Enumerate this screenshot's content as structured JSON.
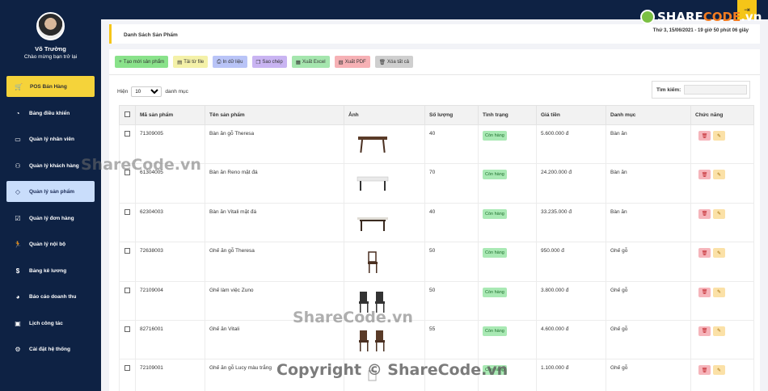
{
  "user": {
    "name": "Võ Trường",
    "welcome": "Chào mừng bạn trở lại"
  },
  "nav": [
    {
      "label": "POS Bán Hàng",
      "icon": "cart-icon",
      "glyph": "🛒"
    },
    {
      "label": "Bảng điều khiển",
      "icon": "dashboard-icon",
      "glyph": "◔"
    },
    {
      "label": "Quản lý nhân viên",
      "icon": "id-card-icon",
      "glyph": "▭"
    },
    {
      "label": "Quản lý khách hàng",
      "icon": "users-icon",
      "glyph": "⚇"
    },
    {
      "label": "Quản lý sản phẩm",
      "icon": "tag-icon",
      "glyph": "◇"
    },
    {
      "label": "Quản lý đơn hàng",
      "icon": "clipboard-check-icon",
      "glyph": "☑"
    },
    {
      "label": "Quản lý nội bộ",
      "icon": "running-icon",
      "glyph": "🏃"
    },
    {
      "label": "Bảng kê lương",
      "icon": "dollar-icon",
      "glyph": "$"
    },
    {
      "label": "Báo cáo doanh thu",
      "icon": "pie-chart-icon",
      "glyph": "◕"
    },
    {
      "label": "Lịch công tác",
      "icon": "calendar-check-icon",
      "glyph": "▣"
    },
    {
      "label": "Cài đặt hệ thống",
      "icon": "gear-icon",
      "glyph": "⚙"
    }
  ],
  "breadcrumb": "Danh Sách Sản Phẩm",
  "date": "Thứ 3, 15/06/2021 - 19 giờ 50 phút 06 giây",
  "toolbar": {
    "add": "Tạo mới sản phẩm",
    "upload": "Tải từ file",
    "print": "In dữ liệu",
    "copy": "Sao chép",
    "excel": "Xuất Excel",
    "pdf": "Xuất PDF",
    "clear": "Xóa tất cả"
  },
  "list": {
    "show": "Hiện",
    "entries": "danh mục",
    "page_size": "10",
    "search_label": "Tìm kiếm:"
  },
  "columns": [
    "Mã sản phẩm",
    "Tên sản phẩm",
    "Ảnh",
    "Số lượng",
    "Tình trạng",
    "Giá tiền",
    "Danh mục",
    "Chức năng"
  ],
  "rows": [
    {
      "code": "71309005",
      "name": "Bàn ăn gỗ Theresa",
      "qty": "40",
      "status": "Còn hàng",
      "price": "5.600.000 đ",
      "category": "Bàn ăn",
      "image": "dining-table-image"
    },
    {
      "code": "61304005",
      "name": "Bàn ăn Reno mặt đá",
      "qty": "70",
      "status": "Còn hàng",
      "price": "24.200.000 đ",
      "category": "Bàn ăn",
      "image": "stone-table-image"
    },
    {
      "code": "62304003",
      "name": "Bàn ăn Vitali mặt đá",
      "qty": "40",
      "status": "Còn hàng",
      "price": "33.235.000 đ",
      "category": "Bàn ăn",
      "image": "stone-table-image"
    },
    {
      "code": "72638003",
      "name": "Ghế ăn gỗ Theresa",
      "qty": "50",
      "status": "Còn hàng",
      "price": "950.000 đ",
      "category": "Ghế gỗ",
      "image": "chair-image"
    },
    {
      "code": "72109004",
      "name": "Ghế làm việc Zuno",
      "qty": "50",
      "status": "Còn hàng",
      "price": "3.800.000 đ",
      "category": "Ghế gỗ",
      "image": "chair-set-image"
    },
    {
      "code": "82716001",
      "name": "Ghế ăn Vitali",
      "qty": "55",
      "status": "Còn hàng",
      "price": "4.600.000 đ",
      "category": "Ghế gỗ",
      "image": "chair-set-image"
    },
    {
      "code": "72109001",
      "name": "Ghế ăn gỗ Lucy màu trắng",
      "qty": "",
      "status": "Còn hàng",
      "price": "1.100.000 đ",
      "category": "Ghế gỗ",
      "image": "white-chair-image"
    }
  ],
  "watermark": {
    "mid1": "ShareCode.vn",
    "mid2": "ShareCode.vn",
    "copyright": "Copyright © ShareCode.vn",
    "logo_a": "SHARE",
    "logo_b": "CODE",
    "logo_c": ".vn"
  },
  "colors": {
    "sidebar": "#0e2244",
    "accent": "#f5c518",
    "active": "#c9ddfb"
  }
}
